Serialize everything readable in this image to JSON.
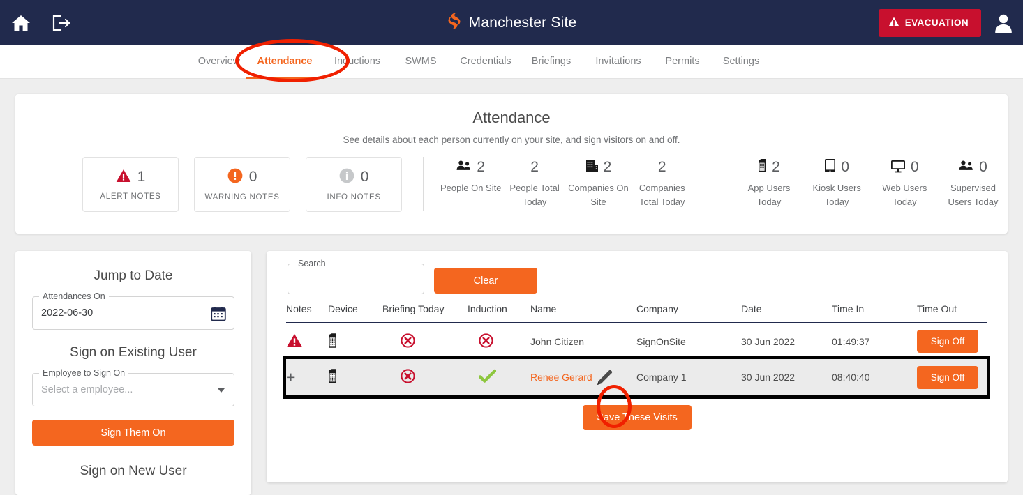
{
  "theme": {
    "navy": "#212a4d",
    "orange": "#f4661f",
    "evac_red": "#c8102e",
    "annotation_red": "#f02000",
    "highlight_row_bg": "#ebebeb"
  },
  "topbar": {
    "home_icon": "home-icon",
    "exit_icon": "exit-door-arrow-icon",
    "logo_icon": "signonsite-logo-icon",
    "site_title": "Manchester Site",
    "evacuation_label": "EVACUATION",
    "evacuation_icon": "warning-triangle-icon",
    "profile_icon": "user-avatar-icon"
  },
  "nav": {
    "items": [
      {
        "label": "Overview",
        "active": false
      },
      {
        "label": "Attendance",
        "active": true
      },
      {
        "label": "Inductions",
        "active": false
      },
      {
        "label": "SWMS",
        "active": false
      },
      {
        "label": "Credentials",
        "active": false
      },
      {
        "label": "Briefings",
        "active": false
      },
      {
        "label": "Invitations",
        "active": false
      },
      {
        "label": "Permits",
        "active": false
      },
      {
        "label": "Settings",
        "active": false
      }
    ]
  },
  "page": {
    "title": "Attendance",
    "subtitle": "See details about each person currently on your site, and sign visitors on and off."
  },
  "note_boxes": [
    {
      "count": "1",
      "label": "ALERT NOTES",
      "icon": "alert-triangle-icon",
      "color": "#c8102e"
    },
    {
      "count": "0",
      "label": "WARNING NOTES",
      "icon": "warning-circle-icon",
      "color": "#f4661f"
    },
    {
      "count": "0",
      "label": "INFO NOTES",
      "icon": "info-circle-icon",
      "color": "#c6c8ca"
    }
  ],
  "metrics": [
    {
      "count": "2",
      "label": "People On Site",
      "icon": "people-group-icon",
      "has_icon": true
    },
    {
      "count": "2",
      "label": "People Total Today",
      "icon": "",
      "has_icon": false
    },
    {
      "count": "2",
      "label": "Companies On Site",
      "icon": "building-icon",
      "has_icon": true
    },
    {
      "count": "2",
      "label": "Companies Total Today",
      "icon": "",
      "has_icon": false
    }
  ],
  "device_metrics": [
    {
      "count": "2",
      "label": "App Users Today",
      "icon": "mobile-phone-icon"
    },
    {
      "count": "0",
      "label": "Kiosk Users Today",
      "icon": "tablet-icon"
    },
    {
      "count": "0",
      "label": "Web Users Today",
      "icon": "desktop-monitor-icon"
    },
    {
      "count": "0",
      "label": "Supervised Users Today",
      "icon": "people-group-icon"
    }
  ],
  "left_panel": {
    "jump_to_date_heading": "Jump to Date",
    "attendances_on_label": "Attendances On",
    "attendances_on_value": "2022-06-30",
    "calendar_icon": "calendar-icon",
    "sign_on_existing_heading": "Sign on Existing User",
    "employee_label": "Employee to Sign On",
    "employee_placeholder": "Select a employee...",
    "sign_them_on_label": "Sign Them On",
    "sign_on_new_heading": "Sign on New User"
  },
  "table_tools": {
    "search_label": "Search",
    "search_value": "",
    "search_placeholder": "",
    "clear_label": "Clear"
  },
  "table": {
    "columns": [
      "Notes",
      "Device",
      "Briefing Today",
      "Induction",
      "Name",
      "Company",
      "Date",
      "Time In",
      "Time Out"
    ],
    "rows": [
      {
        "notes_icon": "alert-triangle-icon",
        "device_icon": "mobile-phone-icon",
        "briefing_icon": "cross-circle-icon",
        "induction_icon": "cross-circle-icon",
        "name": "John Citizen",
        "name_is_link": false,
        "company": "SignOnSite",
        "date": "30 Jun 2022",
        "time_in": "01:49:37",
        "time_out_label": "Sign Off",
        "highlighted": false
      },
      {
        "notes_icon": "plus-icon",
        "device_icon": "mobile-phone-icon",
        "briefing_icon": "cross-circle-icon",
        "induction_icon": "green-check-icon",
        "name": "Renee Gerard",
        "name_is_link": true,
        "company": "Company 1",
        "date": "30 Jun 2022",
        "time_in": "08:40:40",
        "time_out_label": "Sign Off",
        "highlighted": true,
        "edit_icon": "pencil-edit-icon"
      }
    ],
    "save_visits_label": "Save These Visits"
  }
}
